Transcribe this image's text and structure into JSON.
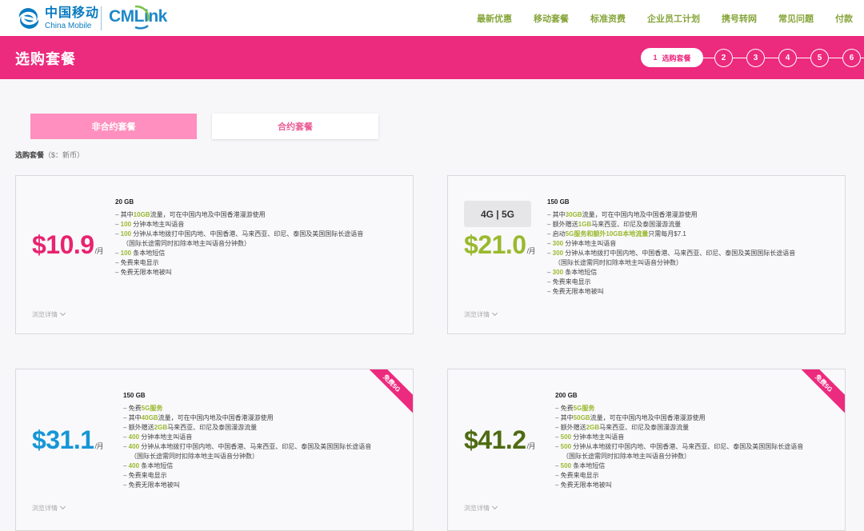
{
  "header": {
    "logo_cn": "中国移动",
    "logo_en": "China Mobile",
    "cmlink": "CMLink",
    "nav": [
      "最新优惠",
      "移动套餐",
      "标准资费",
      "企业员工计划",
      "携号转网",
      "常见问题",
      "付款"
    ]
  },
  "banner": {
    "title": "选购套餐",
    "steps": {
      "active_number": "1",
      "active_label": "选购套餐",
      "others": [
        "2",
        "3",
        "4",
        "5",
        "6"
      ]
    }
  },
  "tabs": {
    "active": "非合约套餐",
    "inactive": "合约套餐"
  },
  "section": {
    "label": "选购套餐",
    "currency": "（$：新币）"
  },
  "colors": {
    "brand_pink": "#ec2a7e",
    "nav_green": "#86a53a",
    "highlight_green": "#9ab92f",
    "price_pink": "#e8236f",
    "price_green": "#9ab92f",
    "price_blue": "#1696d6",
    "price_olive": "#4e6b12"
  },
  "plans": [
    {
      "price": "$10.9",
      "per": "/月",
      "data": "20 GB",
      "lines": [
        [
          "– 其中",
          "10GB",
          "流量，可在中国内地及中国香港漫游使用"
        ],
        [
          "– ",
          "100",
          " 分钟本地主叫语音"
        ],
        [
          "– ",
          "100",
          " 分钟从本地拨打中国内地、中国香港、马来西亚、印尼、泰国及美国国际长途语音"
        ],
        [
          "（国际长途需同时扣除本地主叫语音分钟数）"
        ],
        [
          "– ",
          "100",
          " 条本地短信"
        ],
        [
          "– 免费来电显示"
        ],
        [
          "– 免费无限本地被叫"
        ]
      ],
      "more": "浏览详情"
    },
    {
      "price": "$21.0",
      "per": "/月",
      "badge": "4G | 5G",
      "data": "150 GB",
      "lines": [
        [
          "– 其中",
          "30GB",
          "流量，可在中国内地及中国香港漫游使用"
        ],
        [
          "– 额外赠送",
          "1GB",
          "马来西亚、印尼及泰国漫游流量"
        ],
        [
          "– 启动",
          "5G服务和额外10GB本地流量",
          "只需每月$7.1"
        ],
        [
          "– ",
          "300",
          " 分钟本地主叫语音"
        ],
        [
          "– ",
          "300",
          " 分钟从本地拨打中国内地、中国香港、马来西亚、印尼、泰国及美国国际长途语音"
        ],
        [
          "（国际长途需同时扣除本地主叫语音分钟数）"
        ],
        [
          "– ",
          "300",
          " 条本地短信"
        ],
        [
          "– 免费来电显示"
        ],
        [
          "– 免费无限本地被叫"
        ]
      ],
      "more": "浏览详情"
    },
    {
      "price": "$31.1",
      "per": "/月",
      "ribbon": "免费5G",
      "data": "150 GB",
      "lines": [
        [
          "– 免费",
          "5G服务",
          ""
        ],
        [
          "– 其中",
          "40GB",
          "流量，可在中国内地及中国香港漫游使用"
        ],
        [
          "– 额外赠送",
          "2GB",
          "马来西亚、印尼及泰国漫游流量"
        ],
        [
          "– ",
          "400",
          " 分钟本地主叫语音"
        ],
        [
          "– ",
          "400",
          " 分钟从本地拨打中国内地、中国香港、马来西亚、印尼、泰国及美国国际长途语音"
        ],
        [
          "（国际长途需同时扣除本地主叫语音分钟数）"
        ],
        [
          "– ",
          "400",
          " 条本地短信"
        ],
        [
          "– 免费来电显示"
        ],
        [
          "– 免费无限本地被叫"
        ]
      ],
      "more": "浏览详情"
    },
    {
      "price": "$41.2",
      "per": "/月",
      "ribbon": "免费5G",
      "data": "200 GB",
      "lines": [
        [
          "– 免费",
          "5G服务",
          ""
        ],
        [
          "– 其中",
          "50GB",
          "流量，可在中国内地及中国香港漫游使用"
        ],
        [
          "– 额外赠送",
          "2GB",
          "马来西亚、印尼及泰国漫游流量"
        ],
        [
          "– ",
          "500",
          " 分钟本地主叫语音"
        ],
        [
          "– ",
          "500",
          " 分钟从本地拨打中国内地、中国香港、马来西亚、印尼、泰国及美国国际长途语音"
        ],
        [
          "（国际长途需同时扣除本地主叫语音分钟数）"
        ],
        [
          "– ",
          "500",
          " 条本地短信"
        ],
        [
          "– 免费来电显示"
        ],
        [
          "– 免费无限本地被叫"
        ]
      ],
      "more": "浏览详情"
    }
  ]
}
